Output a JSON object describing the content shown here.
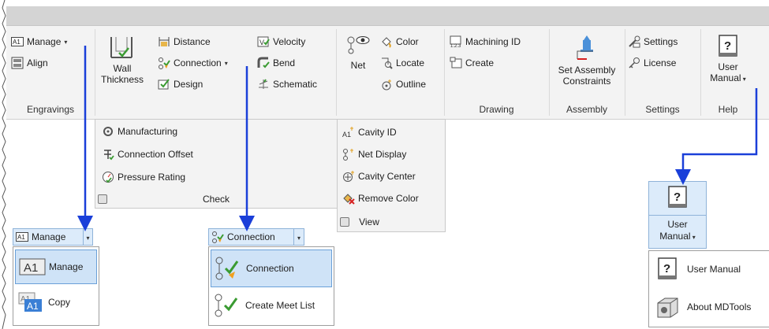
{
  "ribbon": {
    "engravings": {
      "manage": "Manage",
      "align": "Align",
      "group": "Engravings"
    },
    "check_top": {
      "wall_thickness_1": "Wall",
      "wall_thickness_2": "Thickness",
      "distance": "Distance",
      "connection": "Connection",
      "design": "Design",
      "velocity": "Velocity",
      "bend": "Bend",
      "schematic": "Schematic"
    },
    "view_top": {
      "net": "Net",
      "color": "Color",
      "locate": "Locate",
      "outline": "Outline"
    },
    "drawing": {
      "machining_id": "Machining ID",
      "create": "Create",
      "group": "Drawing"
    },
    "assembly": {
      "set_1": "Set Assembly",
      "set_2": "Constraints",
      "group": "Assembly"
    },
    "settings": {
      "settings": "Settings",
      "license": "License",
      "group": "Settings"
    },
    "help": {
      "user_1": "User",
      "user_2": "Manual",
      "group": "Help"
    }
  },
  "check_panel": {
    "manufacturing": "Manufacturing",
    "connection_offset": "Connection Offset",
    "pressure_rating": "Pressure Rating",
    "title": "Check"
  },
  "view_panel": {
    "cavity_id": "Cavity ID",
    "net_display": "Net Display",
    "cavity_center": "Cavity Center",
    "remove_color": "Remove Color",
    "title": "View"
  },
  "manage_dd": {
    "head": "Manage",
    "item1": "Manage",
    "item2": "Copy"
  },
  "connection_dd": {
    "head": "Connection",
    "item1": "Connection",
    "item2": "Create Meet List"
  },
  "help_dd": {
    "head_1": "User",
    "head_2": "Manual",
    "item1": "User Manual",
    "item2": "About MDTools"
  },
  "colors": {
    "arrow": "#1a3fd9",
    "highlight": "#cfe3f7"
  }
}
